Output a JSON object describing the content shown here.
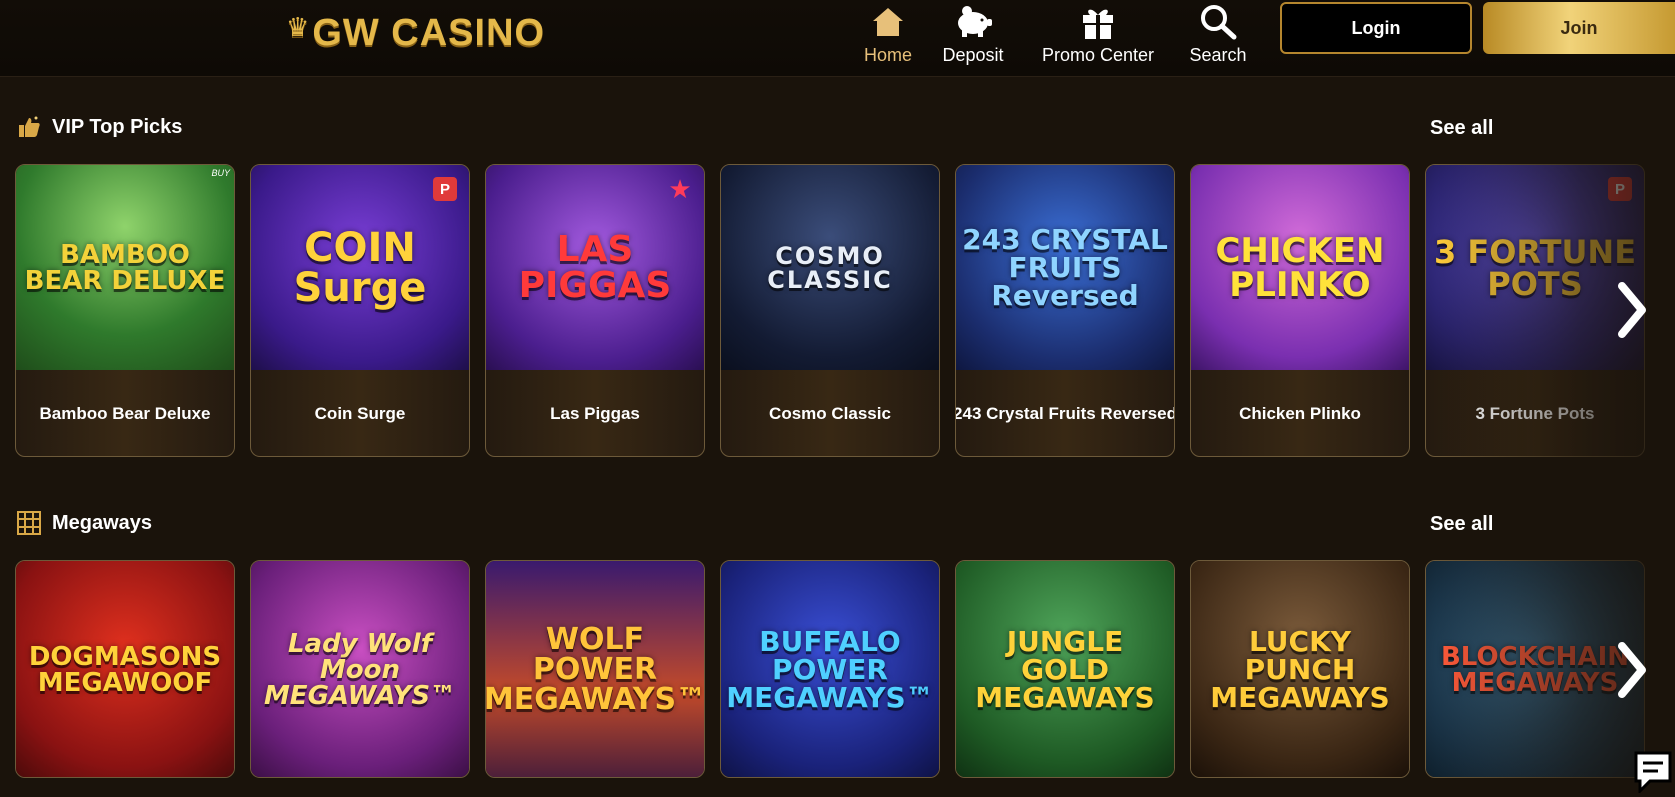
{
  "header": {
    "logo": "GW CASINO",
    "nav": [
      {
        "label": "Home",
        "icon": "home-icon",
        "active": true
      },
      {
        "label": "Deposit",
        "icon": "piggy-bank-icon",
        "active": false
      },
      {
        "label": "Promo Center",
        "icon": "gift-icon",
        "active": false
      },
      {
        "label": "Search",
        "icon": "search-icon",
        "active": false
      }
    ],
    "login_label": "Login",
    "join_label": "Join"
  },
  "sections": [
    {
      "title": "VIP Top Picks",
      "icon": "thumbs-up-icon",
      "see_all": "See all",
      "games": [
        {
          "name": "Bamboo Bear Deluxe",
          "art": "BAMBOO BEAR DELUXE",
          "badge": "BUY"
        },
        {
          "name": "Coin Surge",
          "art": "COIN Surge",
          "badge": "P"
        },
        {
          "name": "Las Piggas",
          "art": "LAS PIGGAS",
          "badge": "★"
        },
        {
          "name": "Cosmo Classic",
          "art": "COSMO CLASSIC",
          "badge": ""
        },
        {
          "name": "243 Crystal Fruits Reversed",
          "art": "243 CRYSTAL FRUITS Reversed",
          "badge": ""
        },
        {
          "name": "Chicken Plinko",
          "art": "CHICKEN PLINKO",
          "badge": ""
        },
        {
          "name": "3 Fortune Pots",
          "art": "3 FORTUNE POTS",
          "badge": "P"
        }
      ]
    },
    {
      "title": "Megaways",
      "icon": "grid-icon",
      "see_all": "See all",
      "games": [
        {
          "name": "Dogmasons Megawoof",
          "art": "DOGMASONS MEGAWOOF"
        },
        {
          "name": "Lady Wolf Moon Megaways",
          "art": "Lady Wolf Moon MEGAWAYS™"
        },
        {
          "name": "Wolf Power Megaways",
          "art": "WOLF POWER MEGAWAYS™"
        },
        {
          "name": "Buffalo Power Megaways",
          "art": "BUFFALO POWER MEGAWAYS™"
        },
        {
          "name": "Jungle Gold Megaways",
          "art": "JUNGLE GOLD MEGAWAYS"
        },
        {
          "name": "Lucky Punch Megaways",
          "art": "LUCKY PUNCH MEGAWAYS"
        },
        {
          "name": "Blockchain Megaways",
          "art": "BLOCKCHAIN MEGAWAYS"
        }
      ]
    }
  ],
  "colors": {
    "background": "#1a130b",
    "accent_gold": "#e4b84a",
    "nav_active": "#e7c07a",
    "card_border": "#6d5a3a"
  }
}
